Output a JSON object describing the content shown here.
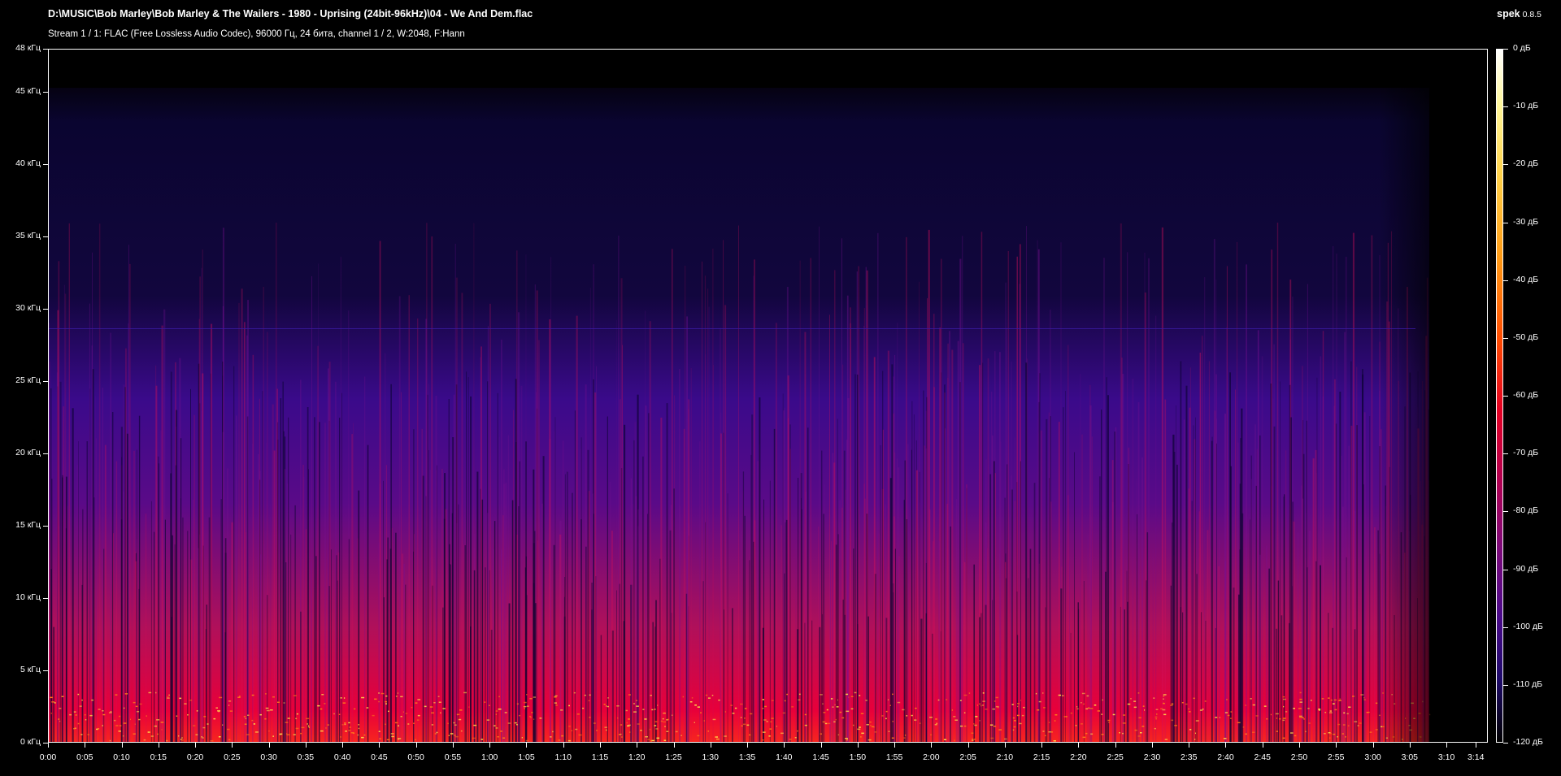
{
  "header": {
    "file_path": "D:\\MUSIC\\Bob Marley\\Bob Marley & The Wailers - 1980 - Uprising (24bit-96kHz)\\04 - We And Dem.flac",
    "stream_info": "Stream 1 / 1: FLAC (Free Lossless Audio Codec), 96000 Гц, 24 бита, channel 1 / 2, W:2048, F:Hann"
  },
  "app": {
    "name": "spek",
    "version": "0.8.5"
  },
  "frequency_axis": {
    "labels": [
      "48 кГц",
      "45 кГц",
      "40 кГц",
      "35 кГц",
      "30 кГц",
      "25 кГц",
      "20 кГц",
      "15 кГц",
      "10 кГц",
      "5 кГц",
      "0 кГц"
    ],
    "values_khz": [
      48,
      45,
      40,
      35,
      30,
      25,
      20,
      15,
      10,
      5,
      0
    ],
    "max_khz": 48
  },
  "time_axis": {
    "labels": [
      "0:00",
      "0:05",
      "0:10",
      "0:15",
      "0:20",
      "0:25",
      "0:30",
      "0:35",
      "0:40",
      "0:45",
      "0:50",
      "0:55",
      "1:00",
      "1:05",
      "1:10",
      "1:15",
      "1:20",
      "1:25",
      "1:30",
      "1:35",
      "1:40",
      "1:45",
      "1:50",
      "1:55",
      "2:00",
      "2:05",
      "2:10",
      "2:15",
      "2:20",
      "2:25",
      "2:30",
      "2:35",
      "2:40",
      "2:45",
      "2:50",
      "2:55",
      "3:00",
      "3:05",
      "3:10",
      "3:14"
    ],
    "seconds": [
      0,
      5,
      10,
      15,
      20,
      25,
      30,
      35,
      40,
      45,
      50,
      55,
      60,
      65,
      70,
      75,
      80,
      85,
      90,
      95,
      100,
      105,
      110,
      115,
      120,
      125,
      130,
      135,
      140,
      145,
      150,
      155,
      160,
      165,
      170,
      175,
      180,
      185,
      190,
      194
    ],
    "duration_s": 195
  },
  "color_scale": {
    "labels": [
      "0 дБ",
      "-10 дБ",
      "-20 дБ",
      "-30 дБ",
      "-40 дБ",
      "-50 дБ",
      "-60 дБ",
      "-70 дБ",
      "-80 дБ",
      "-90 дБ",
      "-100 дБ",
      "-110 дБ",
      "-120 дБ"
    ],
    "values_db": [
      0,
      -10,
      -20,
      -30,
      -40,
      -50,
      -60,
      -70,
      -80,
      -90,
      -100,
      -110,
      -120
    ],
    "min_db": -120
  },
  "colors": {
    "background": "#000000",
    "axis": "#ffffff",
    "hot": "#ffef80",
    "mid": "#e8003a",
    "cool": "#3a0a8a",
    "floor": "#0a0530"
  }
}
